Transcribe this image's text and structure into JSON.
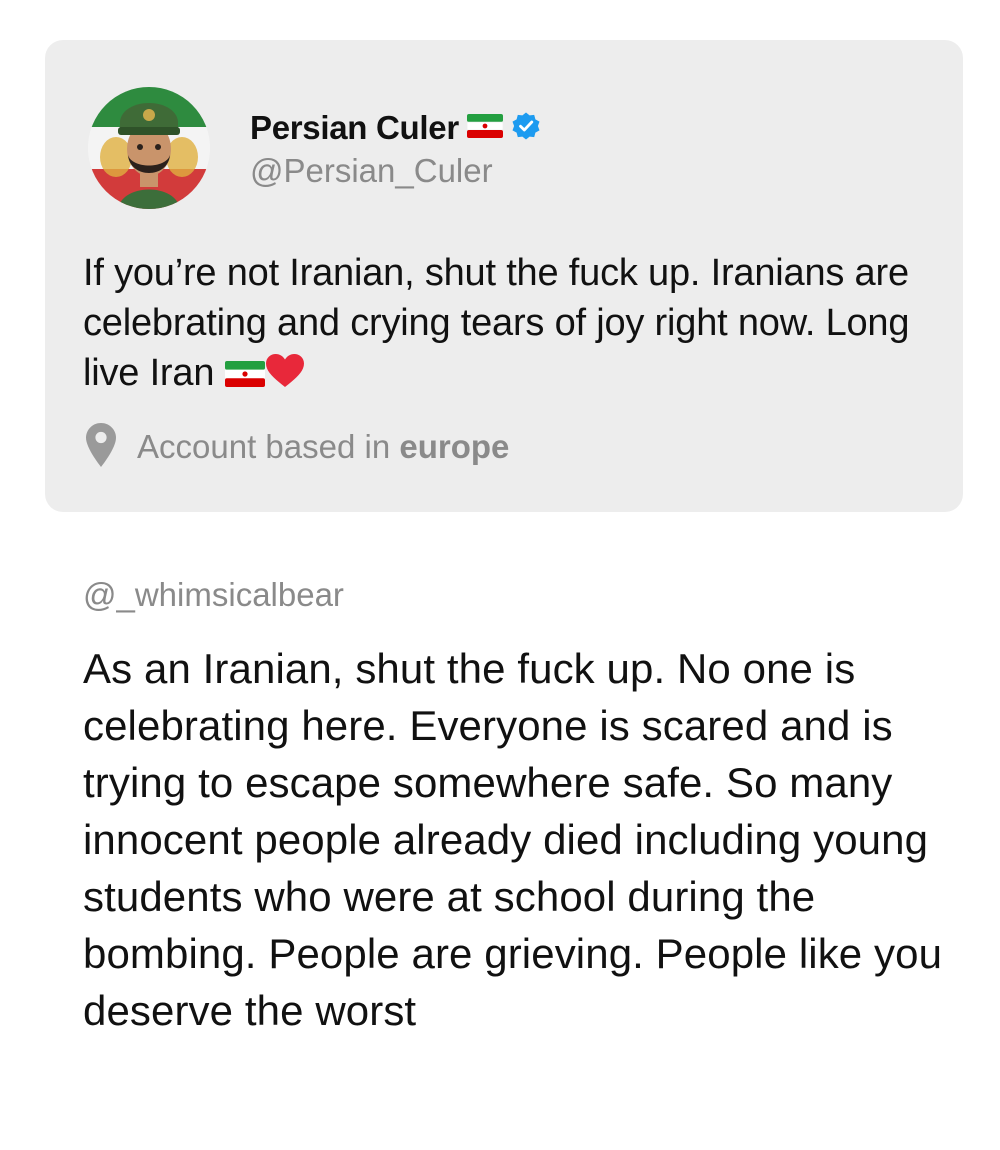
{
  "quoted_post": {
    "display_name": "Persian Culer",
    "handle": "@Persian_Culer",
    "verified": true,
    "flag_icon": "iran-flag-icon",
    "text": "If you’re not Iranian, shut the fuck up. Iranians are celebrating and crying tears of joy right now. Long live Iran",
    "trailing_emojis": [
      "iran-flag-icon",
      "red-heart-icon"
    ],
    "location": {
      "prefix": "Account based in",
      "place": "europe",
      "icon": "location-pin-icon"
    }
  },
  "reply": {
    "handle": "@_whimsicalbear",
    "text": "As an Iranian, shut the fuck up. No one is celebrating here. Everyone is scared and is trying to escape somewhere safe. So many innocent people already died including young students who were at school during the bombing. People are grieving. People like you deserve the worst"
  },
  "colors": {
    "card_background": "#ededed",
    "secondary_text": "#8a8a8a",
    "verified_blue": "#1d9bf0",
    "heart_red": "#e8283a",
    "flag_green": "#239f40",
    "flag_red": "#da0000"
  }
}
